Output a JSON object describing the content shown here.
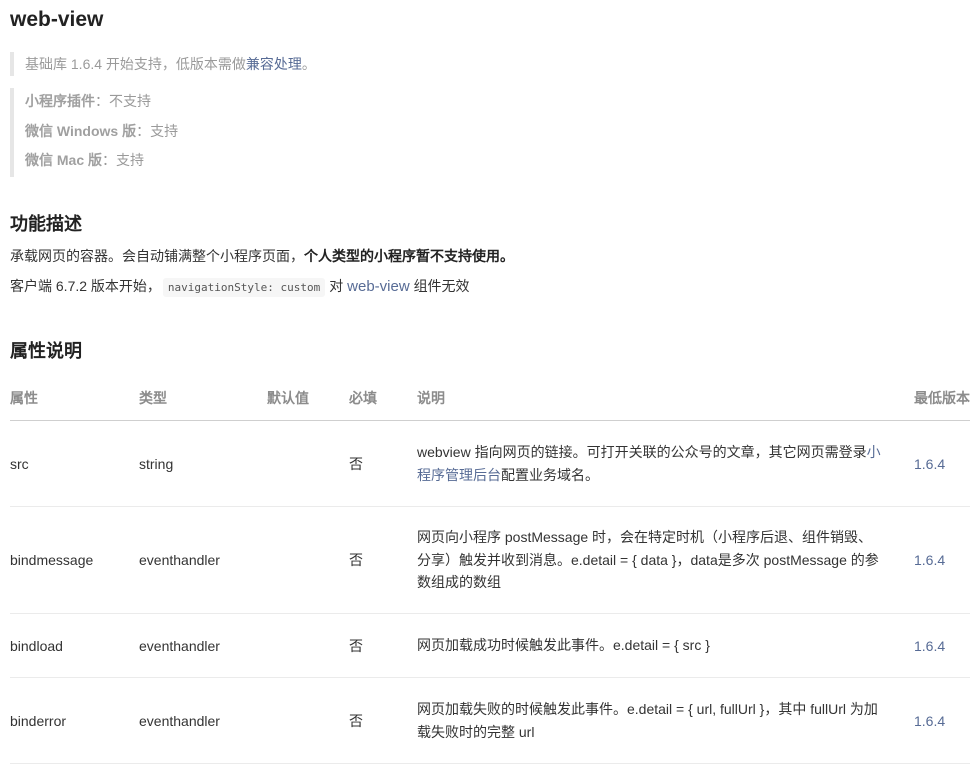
{
  "title": "web-view",
  "support_note": {
    "prefix": "基础库 1.6.4 开始支持，低版本需做",
    "link": "兼容处理",
    "suffix": "。"
  },
  "platforms": [
    {
      "label": "小程序插件",
      "value": "：不支持"
    },
    {
      "label": "微信 Windows 版",
      "value": "：支持"
    },
    {
      "label": "微信 Mac 版",
      "value": "：支持"
    }
  ],
  "func_section": {
    "heading": "功能描述",
    "p1_normal": "承载网页的容器。会自动铺满整个小程序页面，",
    "p1_bold": "个人类型的小程序暂不支持使用。",
    "p2_prefix": "客户端 6.7.2 版本开始，",
    "p2_code": "navigationStyle: custom",
    "p2_mid": "对",
    "p2_blue": "web-view",
    "p2_suffix": "组件无效"
  },
  "attr_section": {
    "heading": "属性说明",
    "headers": [
      "属性",
      "类型",
      "默认值",
      "必填",
      "说明",
      "最低版本"
    ],
    "rows": [
      {
        "name": "src",
        "type": "string",
        "default": "",
        "required": "否",
        "desc_pre": "webview 指向网页的链接。可打开关联的公众号的文章，其它网页需登录",
        "desc_link": "小程序管理后台",
        "desc_post": "配置业务域名。",
        "version": "1.6.4"
      },
      {
        "name": "bindmessage",
        "type": "eventhandler",
        "default": "",
        "required": "否",
        "desc_pre": "网页向小程序 postMessage 时，会在特定时机（小程序后退、组件销毁、分享）触发并收到消息。e.detail = { data }，data是多次 postMessage 的参数组成的数组",
        "desc_link": "",
        "desc_post": "",
        "version": "1.6.4"
      },
      {
        "name": "bindload",
        "type": "eventhandler",
        "default": "",
        "required": "否",
        "desc_pre": "网页加载成功时候触发此事件。e.detail = { src }",
        "desc_link": "",
        "desc_post": "",
        "version": "1.6.4"
      },
      {
        "name": "binderror",
        "type": "eventhandler",
        "default": "",
        "required": "否",
        "desc_pre": "网页加载失败的时候触发此事件。e.detail = { url, fullUrl }，其中 fullUrl 为加载失败时的完整 url",
        "desc_link": "",
        "desc_post": "",
        "version": "1.6.4"
      }
    ]
  }
}
